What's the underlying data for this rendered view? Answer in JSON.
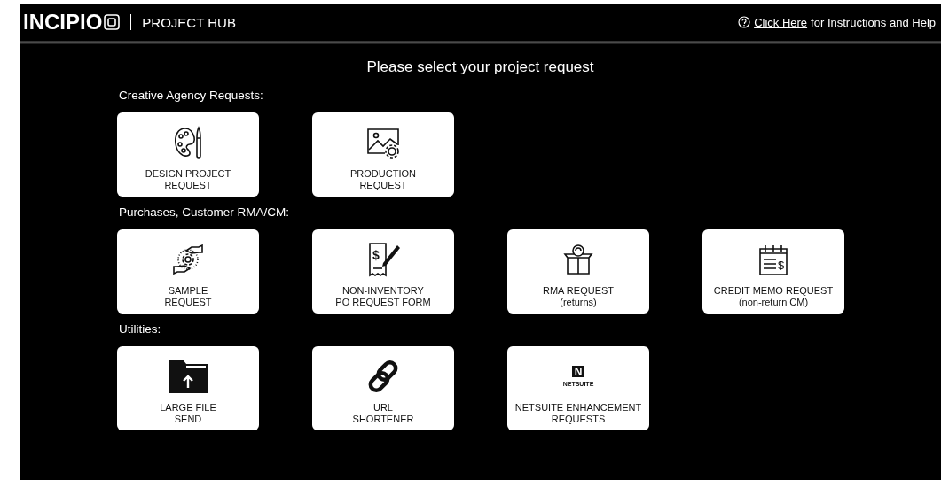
{
  "header": {
    "logo": "INCIPIO",
    "title": "PROJECT HUB",
    "help_link": "Click Here",
    "help_text": "for Instructions and Help"
  },
  "heading": "Please select your project request",
  "sections": [
    {
      "title": "Creative Agency Requests:",
      "cards": [
        {
          "kind": "palette",
          "lines": [
            "DESIGN PROJECT",
            "REQUEST"
          ]
        },
        {
          "kind": "image-gear",
          "lines": [
            "PRODUCTION",
            "REQUEST"
          ]
        }
      ]
    },
    {
      "title": "Purchases, Customer RMA/CM:",
      "cards": [
        {
          "kind": "hands-gear",
          "lines": [
            "SAMPLE",
            "REQUEST"
          ]
        },
        {
          "kind": "receipt",
          "mark": "$",
          "lines": [
            "NON-INVENTORY",
            "PO REQUEST FORM"
          ]
        },
        {
          "kind": "box",
          "lines": [
            "RMA REQUEST",
            "(returns)"
          ]
        },
        {
          "kind": "calendar",
          "mark": "$",
          "lines": [
            "CREDIT MEMO REQUEST",
            "(non-return CM)"
          ]
        }
      ]
    },
    {
      "title": "Utilities:",
      "cards": [
        {
          "kind": "folder",
          "lines": [
            "LARGE FILE",
            "SEND"
          ]
        },
        {
          "kind": "link",
          "lines": [
            "URL",
            "SHORTENER"
          ]
        },
        {
          "kind": "netsuite",
          "mark": "N",
          "logo_text": "NETSUITE",
          "lines": [
            "NETSUITE ENHANCEMENT",
            "REQUESTS"
          ]
        }
      ]
    }
  ]
}
